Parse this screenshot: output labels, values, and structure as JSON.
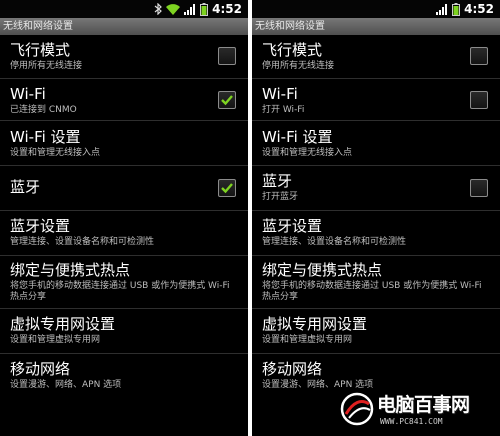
{
  "status_bar": {
    "time": "4:52"
  },
  "title_bar": "无线和网络设置",
  "left_screen": {
    "items": [
      {
        "title": "飞行模式",
        "summary": "停用所有无线连接",
        "checked": false
      },
      {
        "title": "Wi-Fi",
        "summary": "已连接到 CNMO",
        "checked": true
      },
      {
        "title": "Wi-Fi 设置",
        "summary": "设置和管理无线接入点"
      },
      {
        "title": "蓝牙",
        "summary": "",
        "checked": true
      },
      {
        "title": "蓝牙设置",
        "summary": "管理连接、设置设备名称和可检测性"
      },
      {
        "title": "绑定与便携式热点",
        "summary": "将您手机的移动数据连接通过 USB 或作为便携式 Wi-Fi 热点分享"
      },
      {
        "title": "虚拟专用网设置",
        "summary": "设置和管理虚拟专用网"
      },
      {
        "title": "移动网络",
        "summary": "设置漫游、网络、APN 选项"
      }
    ]
  },
  "right_screen": {
    "items": [
      {
        "title": "飞行模式",
        "summary": "停用所有无线连接",
        "checked": false
      },
      {
        "title": "Wi-Fi",
        "summary": "打开 Wi-Fi",
        "checked": false
      },
      {
        "title": "Wi-Fi 设置",
        "summary": "设置和管理无线接入点"
      },
      {
        "title": "蓝牙",
        "summary": "打开蓝牙",
        "checked": false
      },
      {
        "title": "蓝牙设置",
        "summary": "管理连接、设置设备名称和可检测性"
      },
      {
        "title": "绑定与便携式热点",
        "summary": "将您手机的移动数据连接通过 USB 或作为便携式 Wi-Fi 热点分享"
      },
      {
        "title": "虚拟专用网设置",
        "summary": "设置和管理虚拟专用网"
      },
      {
        "title": "移动网络",
        "summary": "设置漫游、网络、APN 选项"
      }
    ]
  },
  "watermark": {
    "brand": "电脑百事网",
    "url": "WWW.PC841.COM"
  },
  "colors": {
    "check_green": "#7ed321",
    "title_bar": "#5f5f5f",
    "background": "#000000"
  },
  "icons": [
    "bluetooth-icon",
    "wifi-icon",
    "signal-icon",
    "battery-icon",
    "checkmark-icon"
  ]
}
